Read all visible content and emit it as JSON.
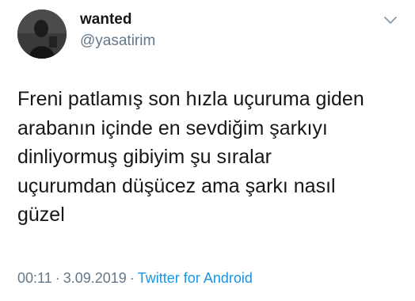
{
  "author": {
    "name": "wanted",
    "handle": "@yasatirim"
  },
  "tweet": {
    "lines": [
      "Freni patlamış son hızla uçuruma giden",
      "arabanın içinde en sevdiğim şarkıyı",
      "dinliyormuş gibiyim şu sıralar",
      "uçurumdan düşücez ama şarkı nasıl",
      "güzel"
    ]
  },
  "meta": {
    "time": "00:11",
    "separator": "·",
    "date": "3.09.2019",
    "source": "Twitter for Android"
  },
  "icons": {
    "avatar": "avatar-photo",
    "menu": "chevron-down-icon"
  },
  "colors": {
    "text": "#14171a",
    "secondary": "#657786",
    "link": "#1b95e0"
  }
}
